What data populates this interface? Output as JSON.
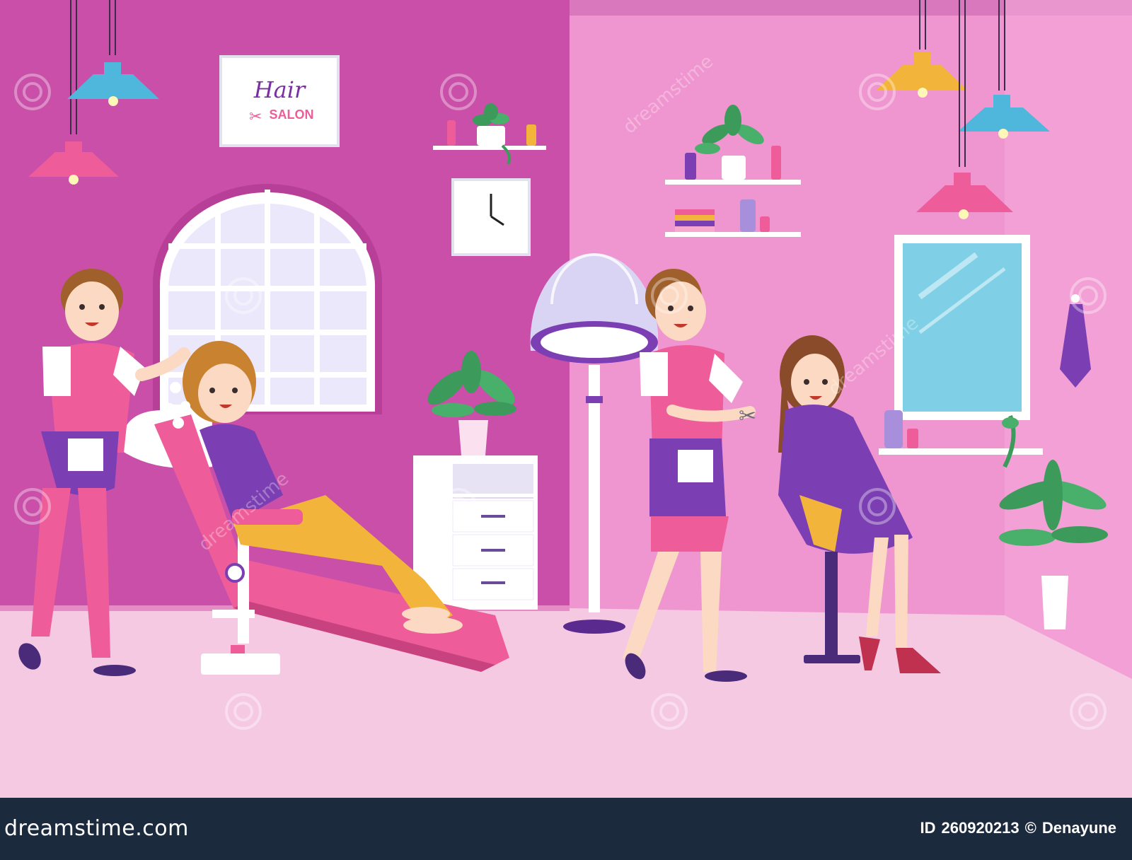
{
  "sign": {
    "line1": "Hair",
    "line2": "SALON"
  },
  "watermark": "dreamstime",
  "footer": {
    "brand": "dreamstime.com",
    "id_label": "ID",
    "id_value": "260920213",
    "copyright": "©",
    "author": "Denayune"
  },
  "colors": {
    "wall_left": "#c94fa8",
    "wall_right": "#ef95cf",
    "floor": "#f6c9e3",
    "footer_bg": "#1c2a3e",
    "apron": "#ee5d9a",
    "purple": "#7b3fb3"
  },
  "icons": [
    "scissors-icon",
    "clock-icon",
    "lamp-icon",
    "plant-icon",
    "dreamstime-spiral-icon"
  ]
}
